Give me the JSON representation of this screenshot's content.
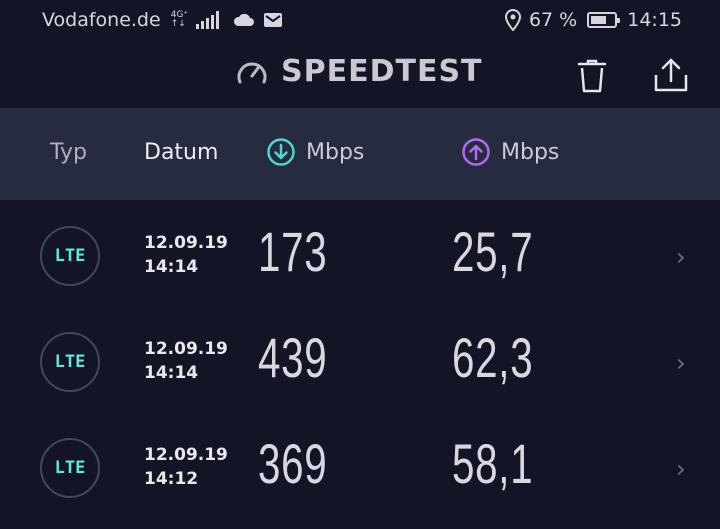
{
  "status_bar": {
    "carrier": "Vodafone.de",
    "network_top": "4G⁺",
    "network_bottom": "↑↓",
    "battery_percent_text": "67 %",
    "battery_level": 0.67,
    "time": "14:15",
    "icons": [
      "signal-icon",
      "cloud-icon",
      "mail-icon",
      "location-icon",
      "battery-icon"
    ]
  },
  "appbar": {
    "title": "SPEEDTEST",
    "icons": [
      "speedometer-icon",
      "trash-icon",
      "share-icon"
    ]
  },
  "columns": {
    "type": "Typ",
    "date": "Datum",
    "download_unit": "Mbps",
    "upload_unit": "Mbps"
  },
  "colors": {
    "background": "#131426",
    "header_bg": "#262b40",
    "download_accent": "#4fd6d0",
    "upload_accent": "#b26bf0",
    "lte_text": "#5fe8da"
  },
  "results": [
    {
      "type": "LTE",
      "date": "12.09.19",
      "time": "14:14",
      "download": "173",
      "upload": "25,7"
    },
    {
      "type": "LTE",
      "date": "12.09.19",
      "time": "14:14",
      "download": "439",
      "upload": "62,3"
    },
    {
      "type": "LTE",
      "date": "12.09.19",
      "time": "14:12",
      "download": "369",
      "upload": "58,1"
    }
  ]
}
